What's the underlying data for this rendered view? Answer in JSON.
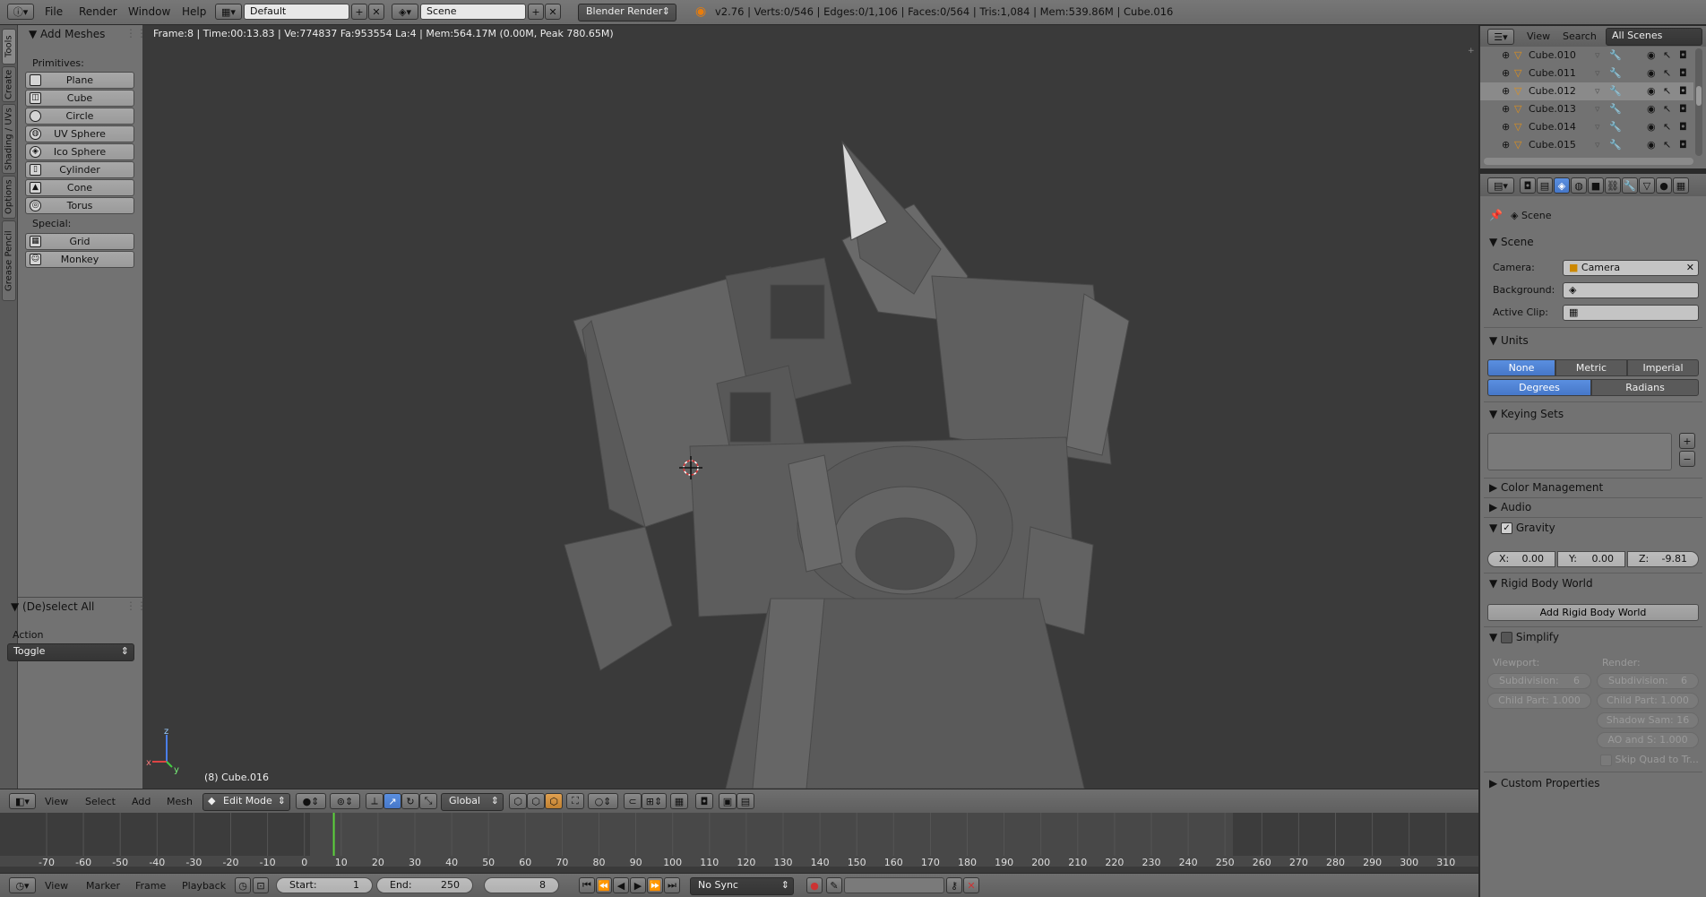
{
  "topbar": {
    "menus": [
      "File",
      "Render",
      "Window",
      "Help"
    ],
    "layout": "Default",
    "scene": "Scene",
    "engine": "Blender Render",
    "stats": "v2.76 | Verts:0/546 | Edges:0/1,106 | Faces:0/564 | Tris:1,084 | Mem:539.86M | Cube.016"
  },
  "vtabs": [
    "Tools",
    "Create",
    "Shading / UVs",
    "Options",
    "Grease Pencil"
  ],
  "add_meshes": {
    "title": "Add Meshes",
    "primitives_label": "Primitives:",
    "primitives": [
      "Plane",
      "Cube",
      "Circle",
      "UV Sphere",
      "Ico Sphere",
      "Cylinder",
      "Cone",
      "Torus"
    ],
    "special_label": "Special:",
    "special": [
      "Grid",
      "Monkey"
    ]
  },
  "operator": {
    "title": "(De)select All",
    "action_label": "Action",
    "action_value": "Toggle"
  },
  "viewport": {
    "info": "Frame:8 | Time:00:13.83 | Ve:774837 Fa:953554 La:4 | Mem:564.17M (0.00M, Peak 780.65M)",
    "object": "(8) Cube.016",
    "axis_x": "x",
    "axis_y": "y",
    "axis_z": "z"
  },
  "view3d_header": {
    "menus": [
      "View",
      "Select",
      "Add",
      "Mesh"
    ],
    "mode": "Edit Mode",
    "orientation": "Global"
  },
  "timeline": {
    "ticks": [
      "-70",
      "-60",
      "-50",
      "-40",
      "-30",
      "-20",
      "-10",
      "0",
      "10",
      "20",
      "30",
      "40",
      "50",
      "60",
      "70",
      "80",
      "90",
      "100",
      "110",
      "120",
      "130",
      "140",
      "150",
      "160",
      "170",
      "180",
      "190",
      "200",
      "210",
      "220",
      "230",
      "240",
      "250",
      "260",
      "270",
      "280",
      "290",
      "300",
      "310"
    ],
    "current_frame": 8,
    "range_start": 1,
    "range_end": 250
  },
  "timeline_header": {
    "menus": [
      "View",
      "Marker",
      "Frame",
      "Playback"
    ],
    "start_label": "Start:",
    "start_value": "1",
    "end_label": "End:",
    "end_value": "250",
    "frame_value": "8",
    "sync": "No Sync"
  },
  "outliner": {
    "menus": [
      "View",
      "Search"
    ],
    "filter": "All Scenes",
    "items": [
      "Cube.010",
      "Cube.011",
      "Cube.012",
      "Cube.013",
      "Cube.014",
      "Cube.015"
    ]
  },
  "properties": {
    "breadcrumb": "Scene",
    "scene_section": "Scene",
    "camera_label": "Camera:",
    "camera_value": "Camera",
    "background_label": "Background:",
    "active_clip_label": "Active Clip:",
    "units_section": "Units",
    "units_options": [
      "None",
      "Metric",
      "Imperial"
    ],
    "rotation_options": [
      "Degrees",
      "Radians"
    ],
    "keying_sets_section": "Keying Sets",
    "color_management": "Color Management",
    "audio": "Audio",
    "gravity": "Gravity",
    "gravity_x": "X:",
    "gravity_x_val": "0.00",
    "gravity_y": "Y:",
    "gravity_y_val": "0.00",
    "gravity_z": "Z:",
    "gravity_z_val": "-9.81",
    "rigid_body_world": "Rigid Body World",
    "add_rigid_body_world": "Add Rigid Body World",
    "simplify": "Simplify",
    "viewport_label": "Viewport:",
    "render_label": "Render:",
    "vp_subdivision_label": "Subdivision:",
    "vp_subdivision": "6",
    "vp_child_part": "Child Part: 1.000",
    "r_subdivision_label": "Subdivision:",
    "r_subdivision": "6",
    "r_child_part": "Child Part: 1.000",
    "r_shadow": "Shadow Sam: 16",
    "r_ao": "AO and S: 1.000",
    "skip_quad": "Skip Quad to Tr...",
    "custom_properties": "Custom Properties"
  }
}
